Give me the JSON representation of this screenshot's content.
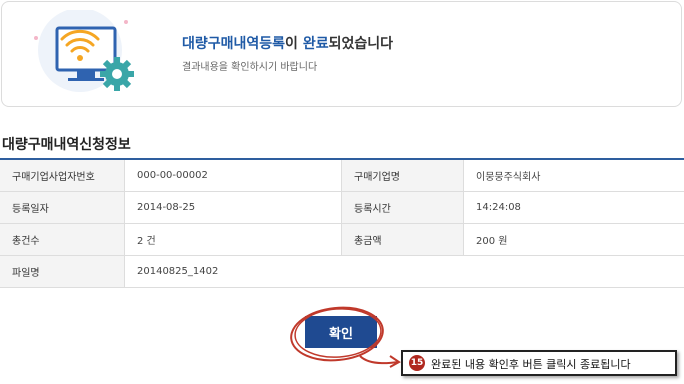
{
  "banner": {
    "title_hl1": "대량구매내역",
    "title_hl2": "등록",
    "title_mid": "이 ",
    "title_hl3": "완료",
    "title_tail": "되었습니다",
    "subtitle": "결과내용을 확인하시기 바랍니다",
    "illustration_icon": "wifi-monitor-gear-icon"
  },
  "section": {
    "title": "대량구매내역신청정보"
  },
  "info": {
    "row1": {
      "l1": "구매기업사업자번호",
      "v1": "000-00-00002",
      "l2": "구매기업명",
      "v2": "이뭉뭉주식회사"
    },
    "row2": {
      "l1": "등록일자",
      "v1": "2014-08-25",
      "l2": "등록시간",
      "v2": "14:24:08"
    },
    "row3": {
      "l1": "총건수",
      "v1": "2 건",
      "l2": "총금액",
      "v2": "200 원"
    },
    "row4": {
      "l1": "파일명",
      "v1": "20140825_1402"
    }
  },
  "confirm_button": {
    "label": "확인"
  },
  "annotation": {
    "number": "15",
    "text": "완료된 내용 확인후 버튼 클릭시 종료됩니다",
    "color": "#c0392b"
  },
  "colors": {
    "accent": "#1f4a91",
    "highlight": "#1f5aa6",
    "annotation": "#c0392b"
  }
}
